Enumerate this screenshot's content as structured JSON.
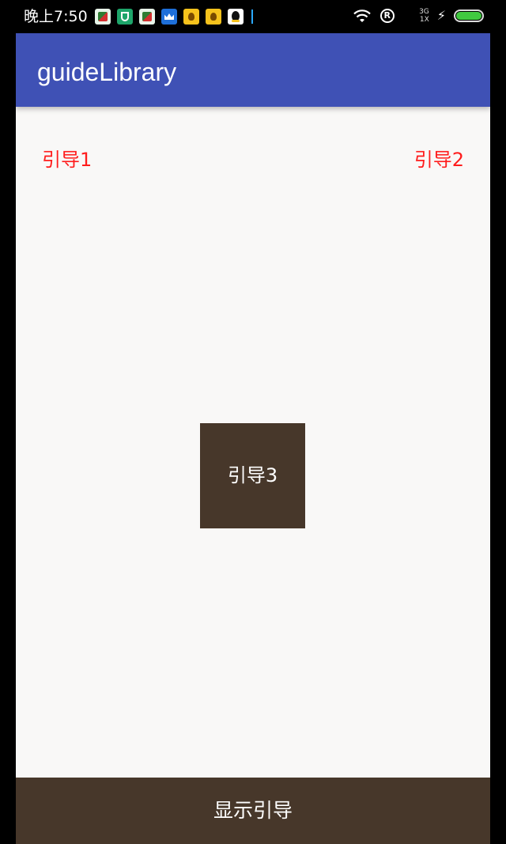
{
  "status_bar": {
    "time": "晚上7:50",
    "notification_icons": [
      "traffic-app-icon",
      "shield-app-icon",
      "traffic-app-icon",
      "crown-app-icon",
      "money-bag-icon",
      "money-bag-icon",
      "qq-penguin-icon"
    ],
    "r_label": "R",
    "network_top": "3G",
    "network_bottom": "1X",
    "charging_icon": "⚡",
    "battery_color": "#41c940"
  },
  "app_bar": {
    "title": "guideLibrary",
    "color": "#3f51b5"
  },
  "content": {
    "guide_1_label": "引导1",
    "guide_2_label": "引导2",
    "guide_3_label": "引导3",
    "guide_text_color": "#ff1c1c",
    "guide_3_color": "#47372a"
  },
  "bottom_button": {
    "label": "显示引导",
    "color": "#47372a"
  }
}
